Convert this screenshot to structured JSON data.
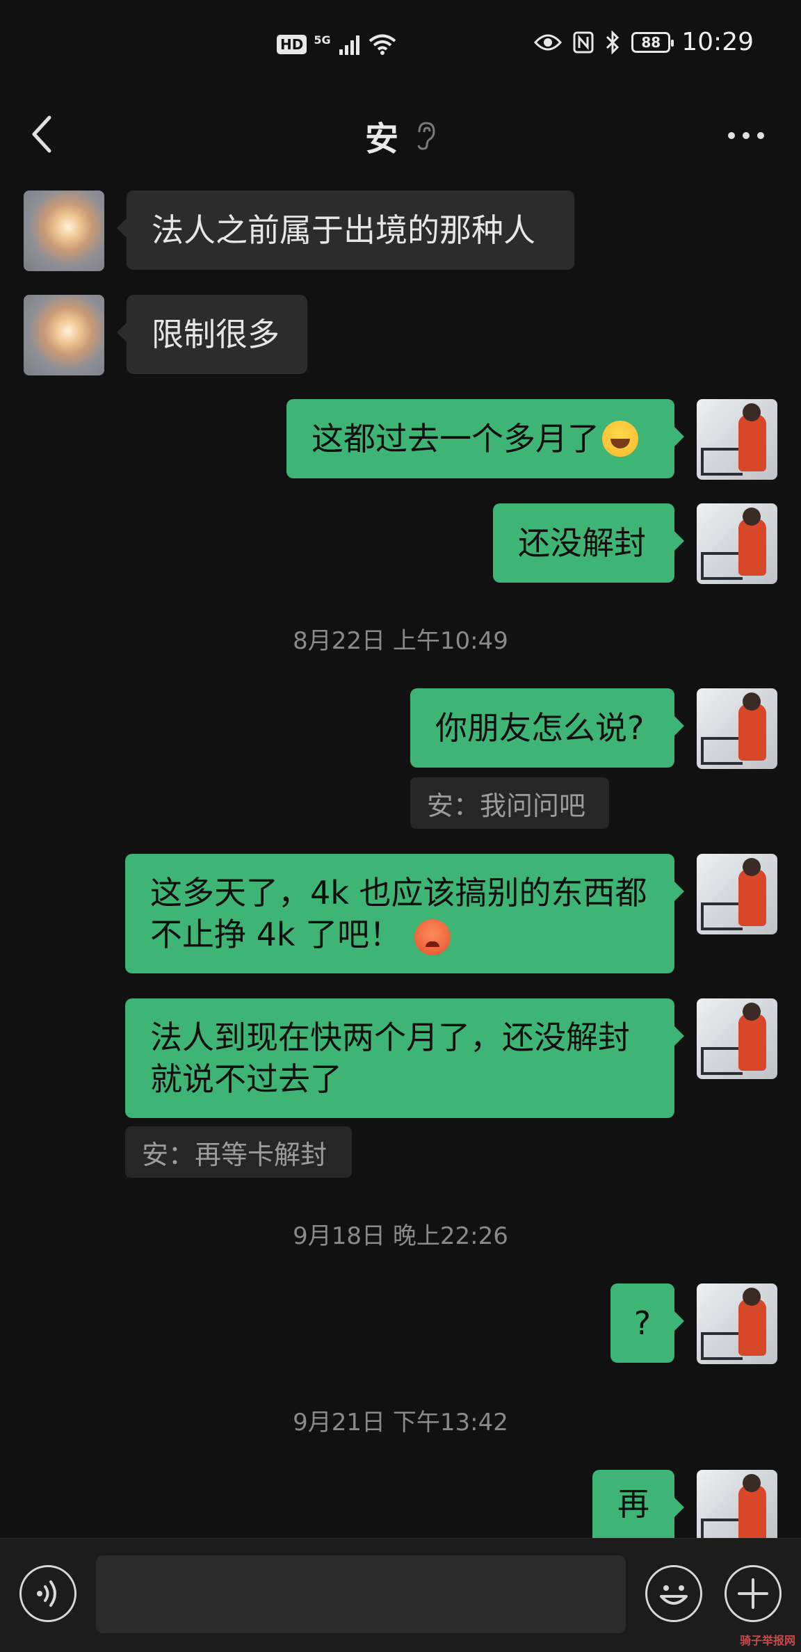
{
  "status_bar": {
    "hd_label": "HD",
    "network_label": "5G",
    "battery_level": "88",
    "time": "10:29"
  },
  "header": {
    "title": "安"
  },
  "messages": [
    {
      "side": "in",
      "text": "法人之前属于出境的那种人"
    },
    {
      "side": "in",
      "text": "限制很多"
    },
    {
      "side": "out",
      "text": "这都过去一个多月了",
      "emoji": "laughing-tears"
    },
    {
      "side": "out",
      "text": "还没解封"
    },
    {
      "side": "out",
      "text": "你朋友怎么说?"
    },
    {
      "side": "out",
      "text_line1": "这多天了，4k 也应该搞别的东西都",
      "text_line2": "不止挣 4k 了吧！",
      "emoji": "angry-sweat"
    },
    {
      "side": "out",
      "text_line1": "法人到现在快两个月了，还没解封",
      "text_line2": "就说不过去了"
    },
    {
      "side": "out",
      "text": "?"
    },
    {
      "side": "out",
      "text": "再"
    }
  ],
  "quotes": [
    "安：我问问吧",
    "安：再等卡解封"
  ],
  "timestamps": [
    "8月22日 上午10:49",
    "9月18日 晚上22:26",
    "9月21日 下午13:42"
  ],
  "watermark": "骑子举报网",
  "colors": {
    "background": "#111111",
    "outgoing_bubble": "#3eb575",
    "incoming_bubble": "#2c2c2c"
  }
}
